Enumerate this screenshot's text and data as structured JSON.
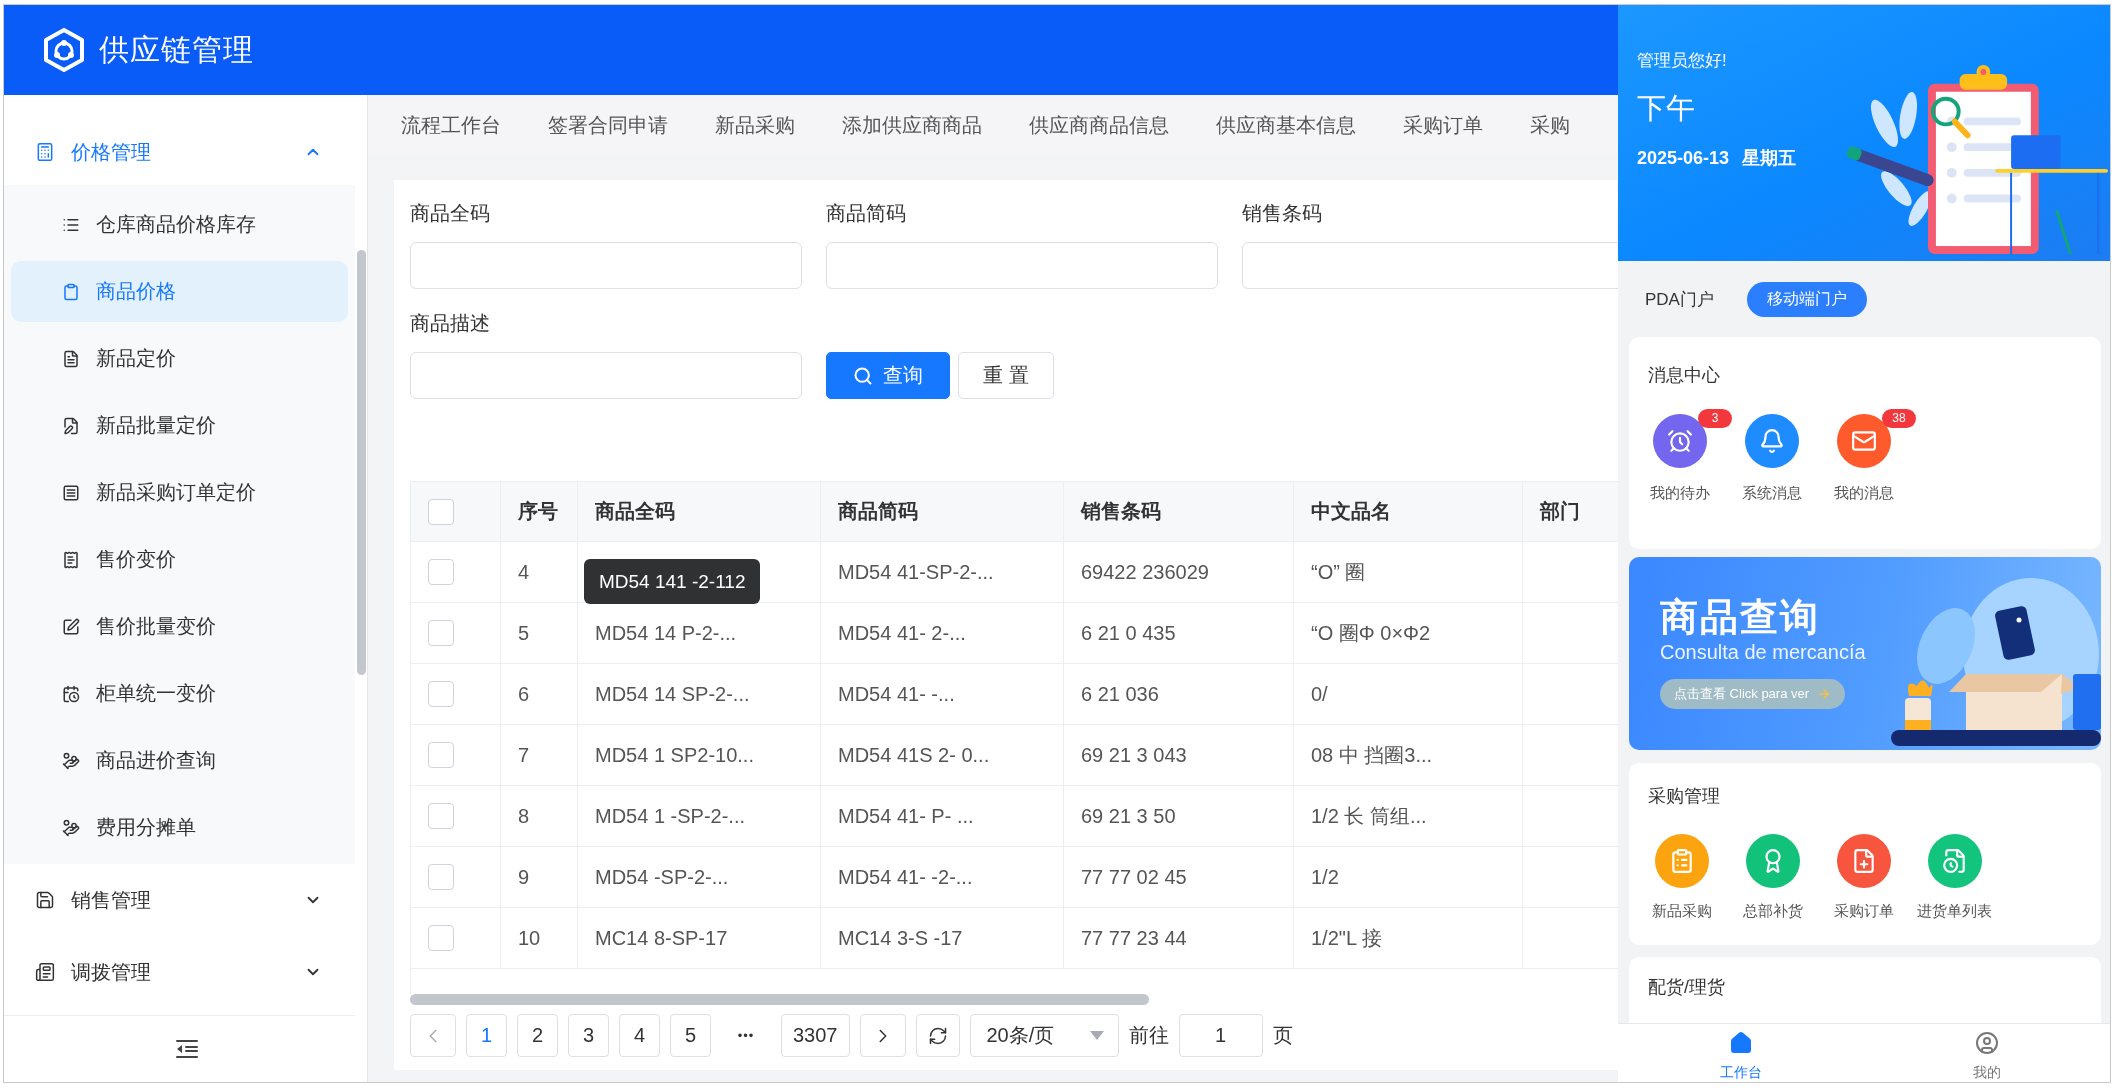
{
  "app": {
    "title": "供应链管理"
  },
  "sidebar": {
    "groups": [
      {
        "label": "价格管理",
        "expanded": true,
        "children": [
          {
            "label": "仓库商品价格库存",
            "selected": false
          },
          {
            "label": "商品价格",
            "selected": true
          },
          {
            "label": "新品定价",
            "selected": false
          },
          {
            "label": "新品批量定价",
            "selected": false
          },
          {
            "label": "新品采购订单定价",
            "selected": false
          },
          {
            "label": "售价变价",
            "selected": false
          },
          {
            "label": "售价批量变价",
            "selected": false
          },
          {
            "label": "柜单统一变价",
            "selected": false
          },
          {
            "label": "商品进价查询",
            "selected": false
          },
          {
            "label": "费用分摊单",
            "selected": false
          }
        ]
      },
      {
        "label": "销售管理",
        "expanded": false
      },
      {
        "label": "调拨管理",
        "expanded": false
      }
    ]
  },
  "tabs": [
    "流程工作台",
    "签署合同申请",
    "新品采购",
    "添加供应商商品",
    "供应商商品信息",
    "供应商基本信息",
    "采购订单",
    "采购"
  ],
  "search_form": {
    "fields": [
      {
        "label": "商品全码"
      },
      {
        "label": "商品简码"
      },
      {
        "label": "销售条码"
      },
      {
        "label": "商品描述"
      }
    ],
    "buttons": [
      {
        "label": "查询",
        "kind": "primary"
      },
      {
        "label": "重 置",
        "kind": "default"
      }
    ]
  },
  "table": {
    "select_all": {
      "checked": false
    },
    "columns": [
      "序号",
      "商品全码",
      "商品简码",
      "销售条码",
      "中文品名",
      "部门"
    ],
    "rows": [
      {
        "checked": false,
        "no": "4",
        "tooltip": "MD54 141 -2-112",
        "short_code": "MD54 41-SP-2-...",
        "barcode": "69422 236029",
        "name": "“O” 圈"
      },
      {
        "checked": false,
        "no": "5",
        "full_code": "MD54 14 P-2-...",
        "short_code": "MD54 41- 2-...",
        "barcode": "6 21 0 435",
        "name": "“O 圈Φ 0×Φ2"
      },
      {
        "checked": false,
        "no": "6",
        "full_code": "MD54 14 SP-2-...",
        "short_code": "MD54 41- -...",
        "barcode": "6 21 036",
        "name": "0/"
      },
      {
        "checked": false,
        "no": "7",
        "full_code": "MD54 1 SP2-10...",
        "short_code": "MD54 41S 2- 0...",
        "barcode": "69 21 3 043",
        "name": "08 中 挡圈3..."
      },
      {
        "checked": false,
        "no": "8",
        "full_code": "MD54 1 -SP-2-...",
        "short_code": "MD54 41- P- ...",
        "barcode": "69 21 3 50",
        "name": "1/2 长 筒组..."
      },
      {
        "checked": false,
        "no": "9",
        "full_code": "MD54 -SP-2-...",
        "short_code": "MD54 41- -2-...",
        "barcode": "77 77 02 45",
        "name": "1/2"
      },
      {
        "checked": false,
        "no": "10",
        "full_code": "MC14 8-SP-17",
        "short_code": "MC14 3-S -17",
        "barcode": "77 77 23 44",
        "name": "1/2\"L 接"
      }
    ]
  },
  "pagination": {
    "pages": [
      {
        "label": "1",
        "selected": true
      },
      {
        "label": "2",
        "selected": false
      },
      {
        "label": "3",
        "selected": false
      },
      {
        "label": "4",
        "selected": false
      },
      {
        "label": "5",
        "selected": false
      }
    ],
    "ellipsis": "•••",
    "last_page": {
      "label": "3307",
      "selected": false
    },
    "page_size": "20条/页",
    "goto_label": "前往",
    "goto_value": "1",
    "goto_suffix": "页"
  },
  "mobile": {
    "greeting": "管理员您好!",
    "period": "下午",
    "date": "2025-06-13 星期五",
    "portal_tabs": [
      {
        "label": "PDA门户",
        "selected": false
      },
      {
        "label": "移动端门户",
        "selected": true
      }
    ],
    "messages": {
      "title": "消息中心",
      "items": [
        {
          "label": "我的待办",
          "badge": "3",
          "color": "#7466ee"
        },
        {
          "label": "系统消息",
          "color": "#1e8cff"
        },
        {
          "label": "我的消息",
          "badge": "38",
          "color": "#ff5a2c"
        }
      ]
    },
    "promo": {
      "title": "商品查询",
      "subtitle": "Consulta de mercancía",
      "action": "点击查看 Click para ver"
    },
    "purchase": {
      "title": "采购管理",
      "items": [
        {
          "label": "新品采购",
          "color": "#fca40f"
        },
        {
          "label": "总部补货",
          "color": "#13c27a"
        },
        {
          "label": "采购订单",
          "color": "#f7553e"
        },
        {
          "label": "进货单列表",
          "color": "#12c47d"
        }
      ]
    },
    "distribution": {
      "title": "配货/理货"
    },
    "bottom_nav": [
      {
        "label": "工作台",
        "selected": true
      },
      {
        "label": "我的",
        "selected": false
      }
    ]
  }
}
